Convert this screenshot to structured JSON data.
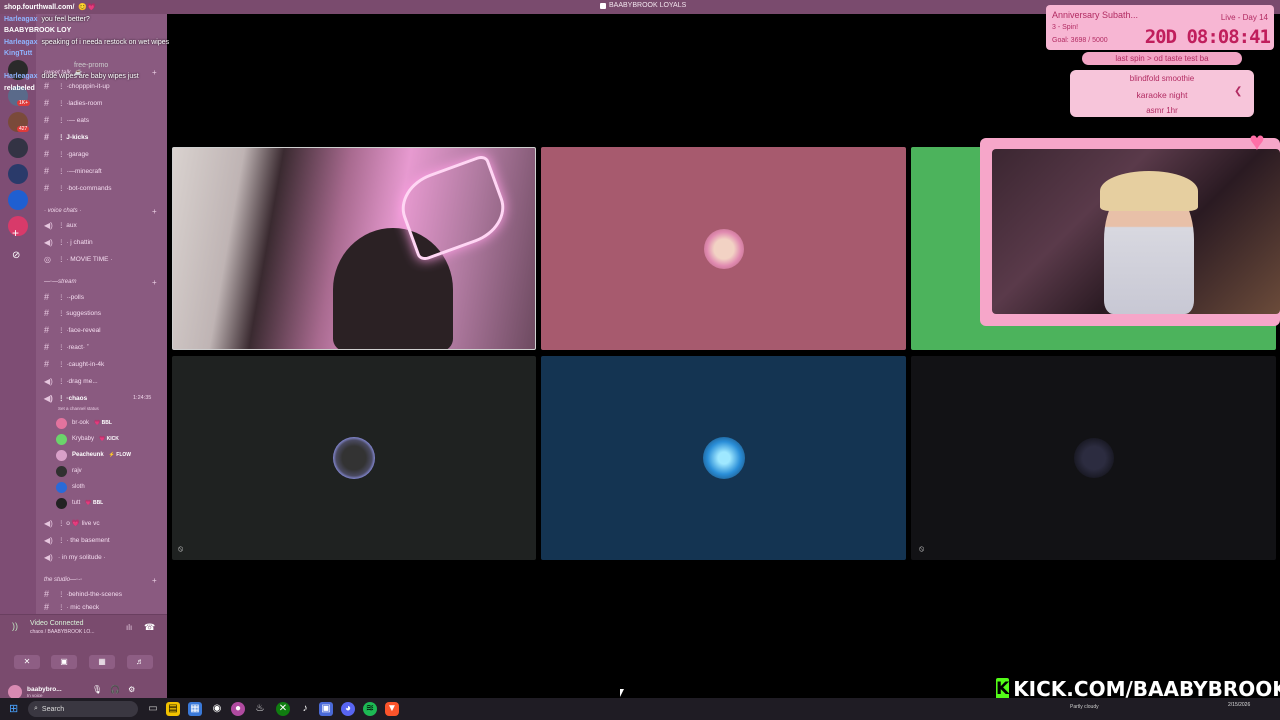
{
  "window": {
    "title": "BAABYBROOK LOYALS"
  },
  "chat": {
    "lines": [
      {
        "user": "shop.fourthwall.com/",
        "message": "",
        "color": "#ffffff"
      },
      {
        "user": "Harleagax",
        "message": "you feel better?",
        "color": "#8fb4ff"
      },
      {
        "user": "BAABYBROOK LOY",
        "message": "",
        "color": "#ffffff"
      },
      {
        "user": "Harleagax",
        "message": "speaking of i needa restock on wet wipes",
        "color": "#8fb4ff"
      },
      {
        "user": "KingTutt",
        "message": "",
        "color": "#8fb4ff"
      },
      {
        "user": "free-promo",
        "message": "",
        "color": "#cccccc"
      },
      {
        "user": "Harleagax",
        "message": "dude wipes are baby wipes just",
        "color": "#8fb4ff"
      },
      {
        "user": "relabeled",
        "message": "",
        "color": "#ffffff"
      }
    ]
  },
  "rail": {
    "servers": [
      {
        "color": "#2a2a2a",
        "badge": ""
      },
      {
        "color": "#5a6a8a",
        "badge": "1K+"
      },
      {
        "color": "#7a4a3a",
        "badge": "427"
      },
      {
        "color": "#333344",
        "badge": ""
      },
      {
        "color": "#2a3a6a",
        "badge": ""
      },
      {
        "color": "#1f5fd1",
        "badge": ""
      },
      {
        "color": "#d83a6a",
        "badge": ""
      }
    ],
    "mod_label": "mod"
  },
  "sidebar": {
    "categories": [
      {
        "label": "sweet talk. ☕ ·"
      },
      {
        "label": "· voice chats ·"
      },
      {
        "label": "—◦—stream"
      },
      {
        "label": "the studio—◦-◦"
      }
    ],
    "text_channels_1": [
      "⋮ ·chopppin-it-up",
      "⋮ ·ladies-room",
      "⋮ ·— eats",
      "⋮ J-kicks",
      "⋮ ·garage",
      "⋮ ·—minecraft",
      "⋮ ·bot-commands"
    ],
    "voice_channels_1": [
      "⋮ aux",
      "⋮ · j chattin",
      "⋮ · MOVIE TIME ·"
    ],
    "stream_channels": [
      "⋮ ·-polls",
      "⋮ suggestions",
      "⋮ ·face-reveal",
      "⋮ ·react· ˚",
      "⋮ ·caught-in-4k",
      "⋮ ·drag me..."
    ],
    "active_voice": {
      "label": "⋮ ·chaos",
      "timer": "1:24:35",
      "status": "Set a channel status"
    },
    "voice_users": [
      {
        "name": "br·ook",
        "badge": "💗 BBL",
        "color": "#e2739e"
      },
      {
        "name": "Krybaby",
        "badge": "💗 KICK",
        "color": "#6bd36b"
      },
      {
        "name": "Peacheunk",
        "badge": "⚡ FLOW",
        "color": "#d8a0c8"
      },
      {
        "name": "rajv",
        "badge": "",
        "color": "#303030"
      },
      {
        "name": "sloth",
        "badge": "",
        "color": "#2a6ad8"
      },
      {
        "name": "tutt",
        "badge": "💗 BBL",
        "color": "#222222"
      }
    ],
    "voice_channels_2": [
      "⋮ o 💗 live vc",
      "⋮ · the basement",
      "· in my solitude ·"
    ],
    "studio_channels": [
      "⋮ ·behind-the-scenes",
      "⋮ · mic check"
    ]
  },
  "voice_panel": {
    "title": "Video Connected",
    "subtitle": "chaos / BAABYBROOK LO...",
    "user_name": "baabybro...",
    "user_status": "In voice"
  },
  "overlay": {
    "sub_title": "Anniversary Subath...",
    "sub_spin": "3 - Spin!",
    "sub_goal": "Goal: 3698 / 5000",
    "live_label": "Live - Day 14",
    "countdown": "20D 08:08:41",
    "spin_bar": "last spin  >  od taste test ba",
    "wheel_options": [
      "blindfold smoothie",
      "karaoke night",
      "asmr 1hr"
    ],
    "kick_url": "KICK.COM/BAABYBROOK",
    "kick_logo": "K"
  },
  "taskbar": {
    "search_placeholder": "Search",
    "weather": "Partly cloudy",
    "date": "2/15/2026"
  }
}
